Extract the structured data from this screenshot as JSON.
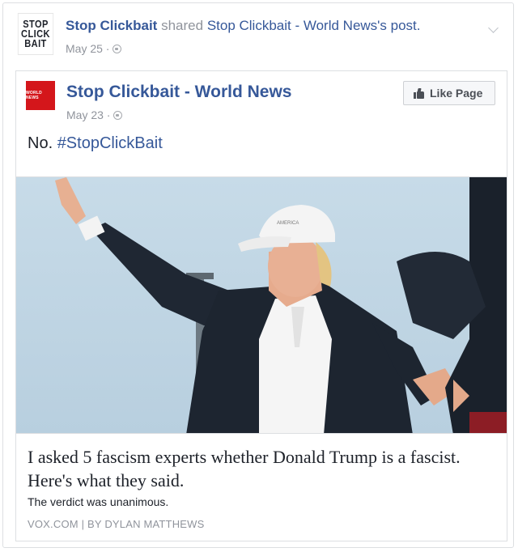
{
  "shared_post": {
    "page_logo_text": [
      "STOP",
      "CLICK",
      "BAIT"
    ],
    "sharer": "Stop Clickbait",
    "action": "shared",
    "original_post_owner": "Stop Clickbait - World News's post.",
    "date": "May 25 · "
  },
  "original_post": {
    "page_logo_text": "WORLD NEWS",
    "page_name": "Stop Clickbait - World News",
    "date": "May 23 · ",
    "like_button_label": "Like Page",
    "status_text": "No. ",
    "hashtag": "#StopClickBait"
  },
  "link_preview": {
    "title": "I asked 5 fascism experts whether Donald Trump is a fascist. Here's what they said.",
    "description": "The verdict was unanimous.",
    "caption": "VOX.COM | BY DYLAN MATTHEWS"
  },
  "colors": {
    "link_blue": "#365899",
    "meta_gray": "#90949c",
    "logo_red": "#d4161b"
  },
  "icons": [
    "globe-icon",
    "chevron-down-icon",
    "thumbs-up-icon"
  ]
}
